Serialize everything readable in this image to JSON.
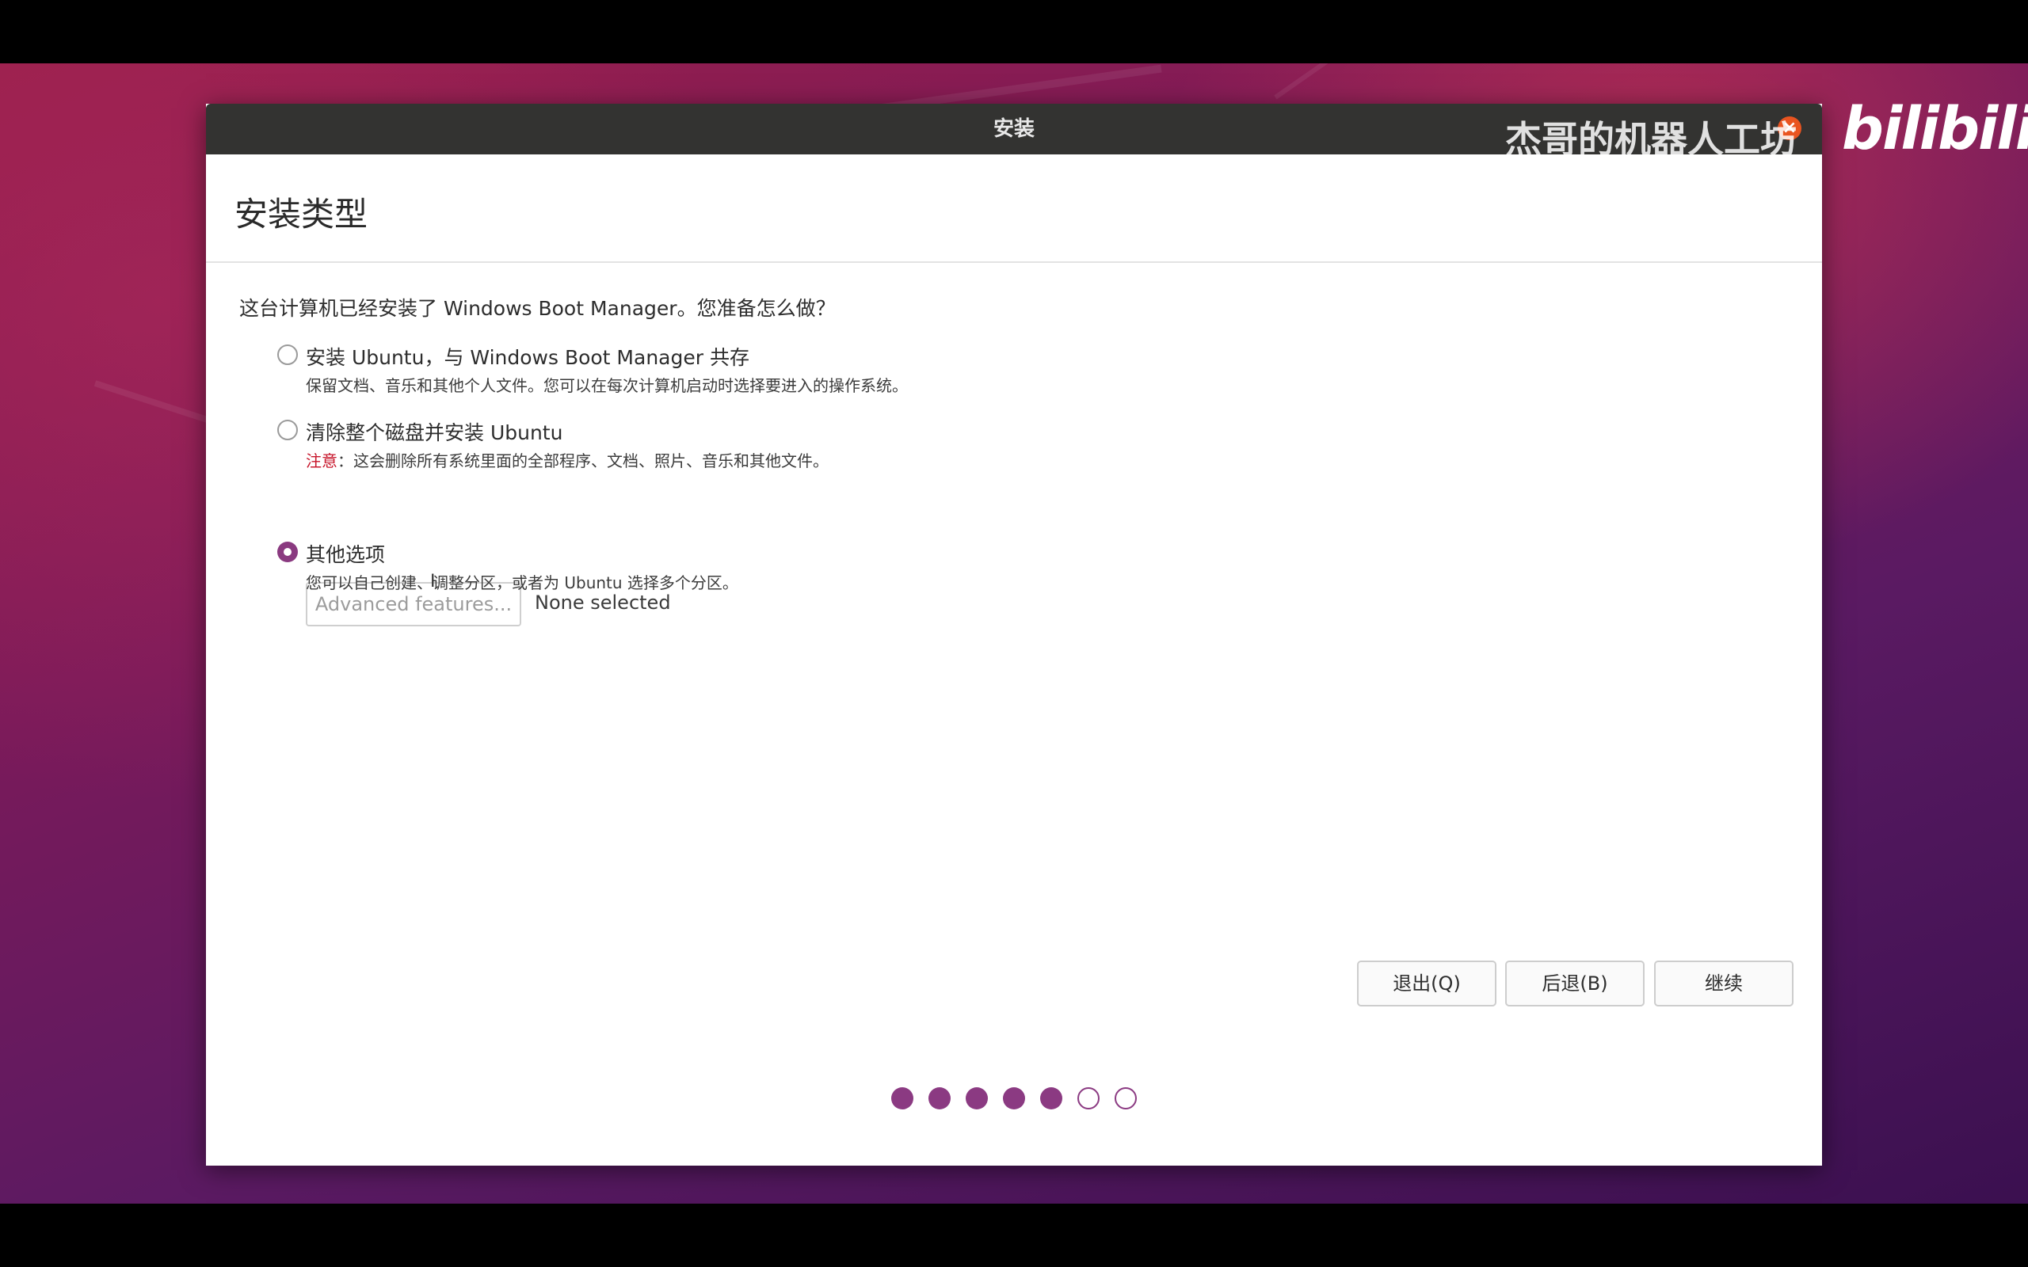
{
  "window": {
    "title": "安装",
    "close_glyph": "×"
  },
  "page": {
    "title": "安装类型",
    "question": "这台计算机已经安装了 Windows Boot Manager。您准备怎么做？"
  },
  "options": [
    {
      "label": "安装 Ubuntu，与 Windows Boot Manager 共存",
      "desc": "保留文档、音乐和其他个人文件。您可以在每次计算机启动时选择要进入的操作系统。",
      "selected": false
    },
    {
      "label": "清除整个磁盘并安装 Ubuntu",
      "warn_prefix": "注意",
      "desc": "：这会删除所有系统里面的全部程序、文档、照片、音乐和其他文件。",
      "selected": false
    },
    {
      "label": "其他选项",
      "desc": "您可以自己创建、调整分区，或者为 Ubuntu 选择多个分区。",
      "selected": true
    }
  ],
  "advanced": {
    "button_label": "Advanced features...",
    "status": "None selected"
  },
  "buttons": {
    "quit": "退出(Q)",
    "back": "后退(B)",
    "continue": "继续"
  },
  "progress": {
    "total_steps": 7,
    "completed_steps": 5
  },
  "overlay": {
    "watermark": "杰哥的机器人工坊",
    "brand": "bilibili"
  },
  "colors": {
    "accent": "#8b3a82",
    "titlebar": "#333331",
    "close": "#e95420",
    "warning": "#c7162b"
  },
  "icons": {
    "cursor": "text-cursor-icon"
  }
}
